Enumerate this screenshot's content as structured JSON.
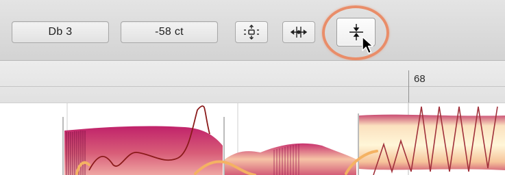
{
  "toolbar": {
    "pitch_value": "Db 3",
    "cents_value": "-58 ct",
    "tools": [
      {
        "name": "pitch-tool",
        "icon": "pitch-tool-icon"
      },
      {
        "name": "formant-tool",
        "icon": "formant-tool-icon"
      },
      {
        "name": "amplitude-tool",
        "icon": "amplitude-tool-icon",
        "selected": true
      }
    ]
  },
  "ruler": {
    "bar_number": "68"
  },
  "colors": {
    "highlight_ring": "#e98d69",
    "blob_dark": "#a0195e",
    "blob_mid": "#d84f6e",
    "blob_light": "#fde5c0",
    "pitch_curve": "#8a1a1a",
    "pitch_drift": "#f4b263"
  }
}
